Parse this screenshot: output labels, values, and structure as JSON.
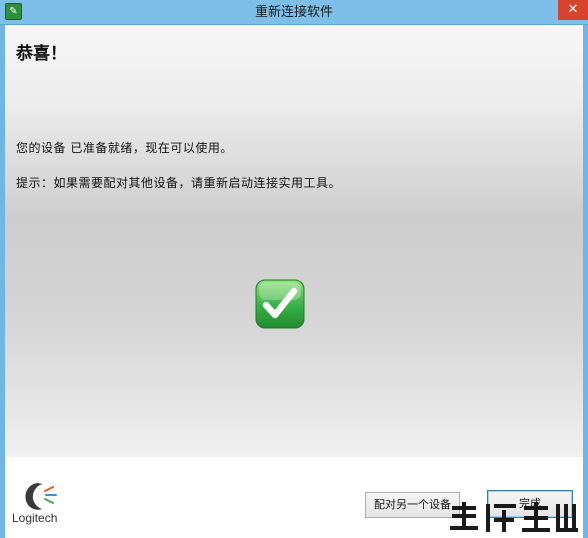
{
  "window": {
    "title": "重新连接软件",
    "close_label": "✕",
    "app_icon_glyph": "✎"
  },
  "content": {
    "heading": "恭喜！",
    "message": "您的设备 已准备就绪，现在可以使用。",
    "hint": "提示：如果需要配对其他设备，请重新启动连接实用工具。",
    "status_icon": "check-icon"
  },
  "footer": {
    "logo_text": "Logitech",
    "pair_button_label": "配对另一个设备",
    "finish_button_label": "完成"
  },
  "colors": {
    "titlebar": "#7dbfe8",
    "close_button": "#d8432f",
    "check_green": "#3bb54a",
    "check_green_dark": "#1f7a2a"
  }
}
